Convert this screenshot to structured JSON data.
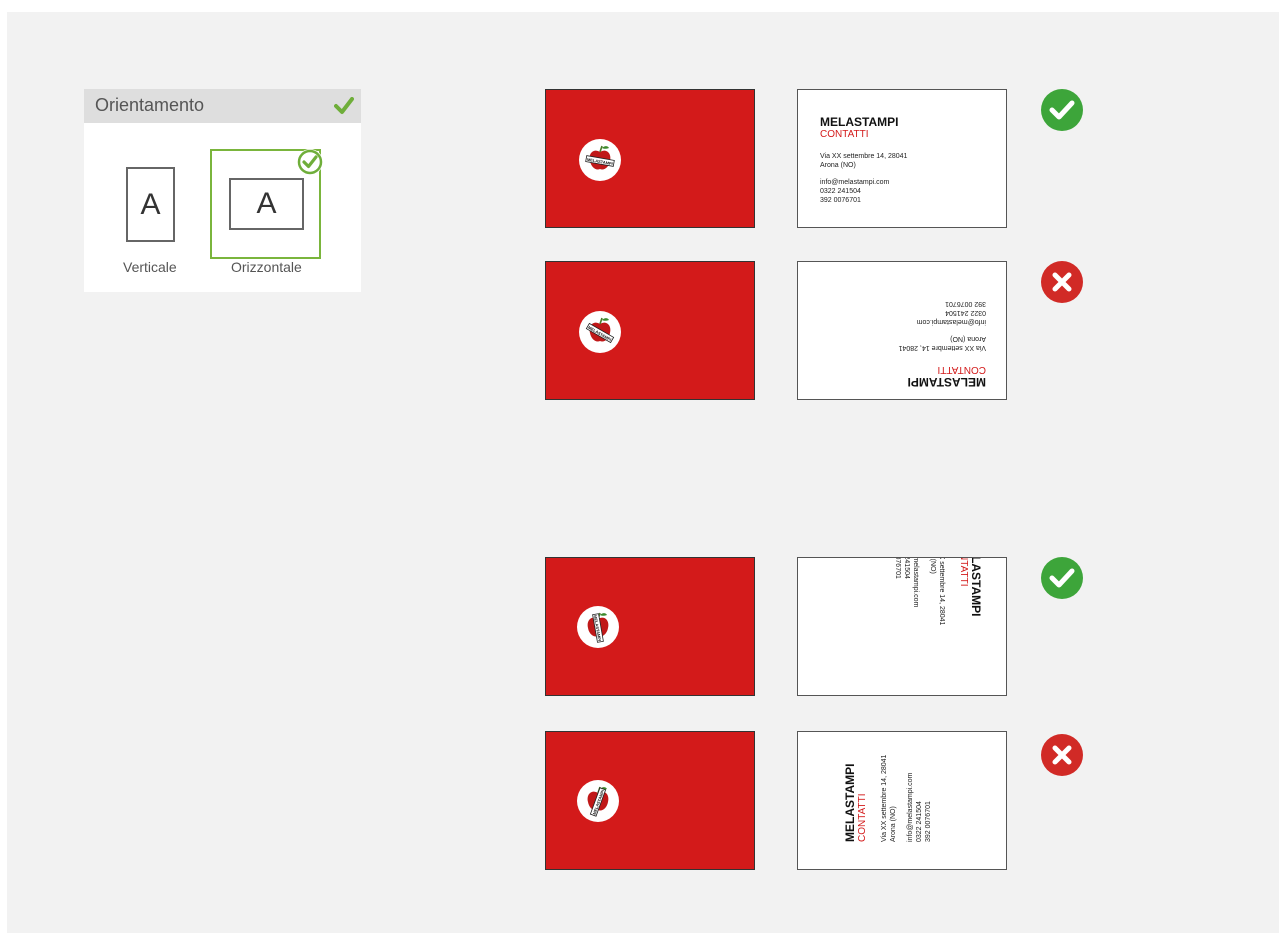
{
  "orientation_panel": {
    "title": "Orientamento",
    "options": [
      {
        "label": "Verticale",
        "letter": "A",
        "selected": false
      },
      {
        "label": "Orizzontale",
        "letter": "A",
        "selected": true
      }
    ]
  },
  "card": {
    "brand": "MELASTAMPI",
    "subtitle": "CONTATTI",
    "address_line1": "Via XX settembre 14, 28041",
    "address_line2": "Arona (NO)",
    "email": "info@melastampi.com",
    "phone1": "0322 241504",
    "phone2": "392 0076701",
    "logo_text": "MELASTAMPI"
  },
  "examples": [
    {
      "layout": "landscape-upright",
      "status": "correct"
    },
    {
      "layout": "landscape-upside-down",
      "status": "wrong"
    },
    {
      "layout": "portrait-rotated-cw",
      "status": "correct"
    },
    {
      "layout": "portrait-rotated-ccw",
      "status": "wrong"
    }
  ],
  "colors": {
    "red": "#d31a1a",
    "green_ok": "#3da53a",
    "red_wrong": "#d12a26",
    "selected_border": "#7ab53c",
    "background": "#f2f2f2"
  },
  "icons": {
    "header": "check-icon",
    "correct": "check-circle-icon",
    "wrong": "x-circle-icon",
    "logo": "apple-logo-icon"
  }
}
